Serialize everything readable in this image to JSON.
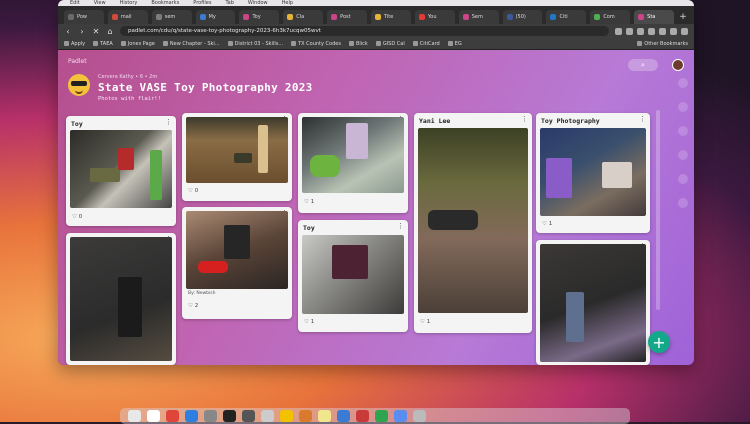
{
  "menubar": {
    "items": [
      "Edit",
      "View",
      "History",
      "Bookmarks",
      "Profiles",
      "Tab",
      "Window",
      "Help"
    ]
  },
  "tabs": [
    {
      "label": "Pow",
      "color": "#6b6b6b"
    },
    {
      "label": "mail",
      "color": "#d24a3b"
    },
    {
      "label": "sem",
      "color": "#7c7c7c"
    },
    {
      "label": "My",
      "color": "#3b7bd2"
    },
    {
      "label": "Toy",
      "color": "#cc4488"
    },
    {
      "label": "Cla",
      "color": "#e4b337"
    },
    {
      "label": "Post",
      "color": "#cc4488"
    },
    {
      "label": "Tite",
      "color": "#e4b337"
    },
    {
      "label": "You",
      "color": "#e53935"
    },
    {
      "label": "Sem",
      "color": "#cc4488"
    },
    {
      "label": "(50)",
      "color": "#3b5998"
    },
    {
      "label": "Citi",
      "color": "#1f77c8"
    },
    {
      "label": "Com",
      "color": "#4caf50"
    },
    {
      "label": "Sta",
      "color": "#cc4488",
      "active": true
    }
  ],
  "address": {
    "url": "padlet.com/cdu/q/state-vase-toy-photography-2023-6h3k7ucqw05wvt"
  },
  "bookmarks": [
    {
      "label": "Apply"
    },
    {
      "label": "TAEA"
    },
    {
      "label": "Jones Page"
    },
    {
      "label": "New Chapter - Ski..."
    },
    {
      "label": "District 03 - Skills..."
    },
    {
      "label": "TX County Codes"
    },
    {
      "label": "Blick"
    },
    {
      "label": "GISD Cal"
    },
    {
      "label": "CitiCard"
    },
    {
      "label": "EG"
    },
    {
      "label": "Other Bookmarks"
    }
  ],
  "padlet": {
    "brand": "Padlet",
    "meta": "Cervera Kathy  •  6  •  2m",
    "title": "State VASE Toy Photography 2023",
    "subtitle": "Photos with flair!!"
  },
  "cards": [
    {
      "title": "Toy",
      "likes": "0"
    },
    {
      "title": "",
      "likes": ""
    },
    {
      "title": "",
      "likes": "0"
    },
    {
      "title": "",
      "likes": "2",
      "author": "By: Newbish"
    },
    {
      "title": "",
      "likes": "1"
    },
    {
      "title": "Toy",
      "likes": "1"
    },
    {
      "title": "Yani Lee",
      "likes": "1"
    },
    {
      "title": "Toy Photography",
      "likes": "1"
    },
    {
      "title": "",
      "likes": ""
    }
  ],
  "fab": {
    "label": "+"
  },
  "search": {
    "icon": "search-icon"
  }
}
